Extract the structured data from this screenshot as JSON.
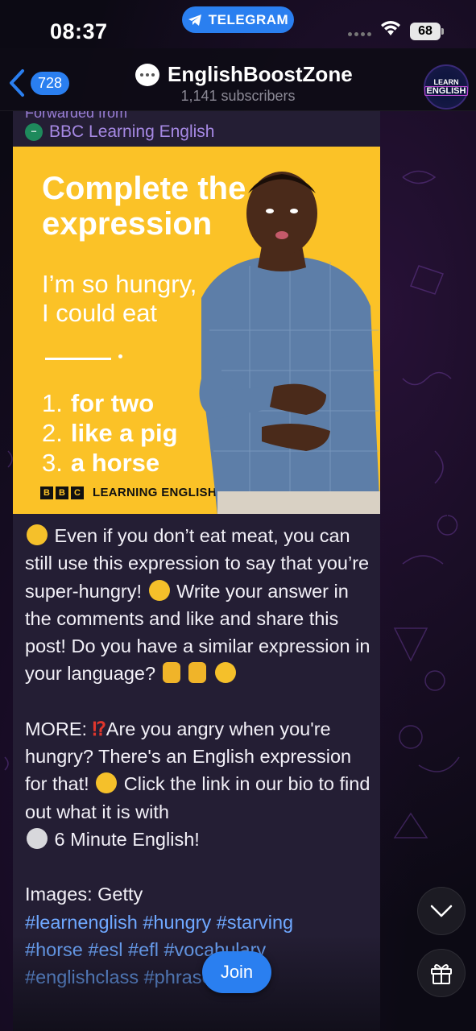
{
  "status_bar": {
    "time": "08:37",
    "app_pill": "TELEGRAM",
    "battery": "68"
  },
  "header": {
    "back_count": "728",
    "channel_name": "EnglishBoostZone",
    "subscribers": "1,141 subscribers",
    "avatar_line1": "LEARN",
    "avatar_line2": "ENGLISH"
  },
  "message": {
    "forwarded_label": "Forwarded from",
    "forwarded_source": "BBC Learning English",
    "image": {
      "title": "Complete the expression",
      "phrase_line1": "I’m so hungry,",
      "phrase_line2": "I could eat",
      "options": [
        {
          "num": "1.",
          "text": "for two"
        },
        {
          "num": "2.",
          "text": "like a pig"
        },
        {
          "num": "3.",
          "text": "a horse"
        }
      ],
      "logo_letters": [
        "B",
        "B",
        "C"
      ],
      "logo_text": "LEARNING ENGLISH"
    },
    "para1_a": "Even if you don’t eat meat, you can still use this expression to say that you’re super-hungry!",
    "para1_b": "Write your answer in the comments and like and share this post! Do you have a similar expression in your language?",
    "para2_prefix": "MORE:",
    "para2_a": "Are you angry when you're hungry? There's an English expression for that!",
    "para2_b": "Click the link in our bio to find out what it is with",
    "para2_c": "6 Minute English!",
    "images_credit": "Images: Getty",
    "hashtags_1": "#learnenglish #hungry #starving",
    "hashtags_2": "#horse #esl #efl #vocabulary",
    "hashtags_3": "#englishclass #phrases"
  },
  "buttons": {
    "join": "Join"
  },
  "colors": {
    "accent": "#2a7ff0",
    "bubble": "#241e34",
    "image_bg": "#fbc227",
    "hashtag": "#6fa8ff",
    "forward": "#a689e4"
  }
}
